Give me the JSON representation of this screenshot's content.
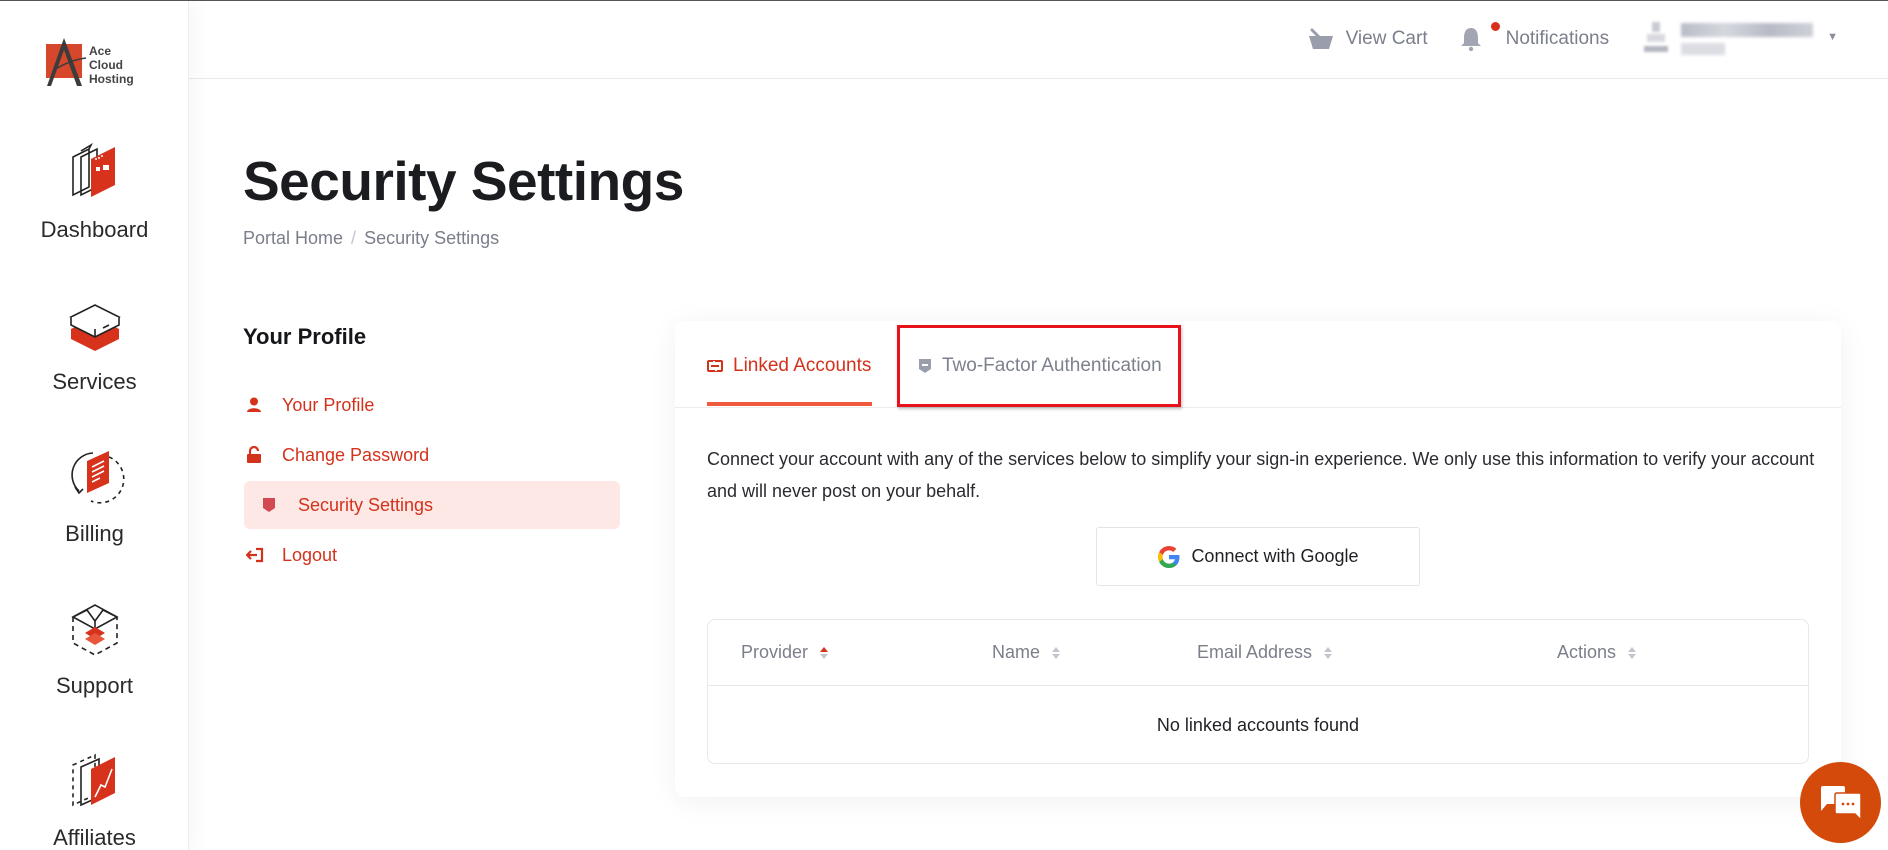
{
  "brand": {
    "name_lines": [
      "Ace",
      "Cloud",
      "Hosting"
    ],
    "accent_color": "#d3321c",
    "logo_red": "#d6472b"
  },
  "nav": {
    "items": [
      {
        "label": "Dashboard",
        "icon": "dashboard-icon"
      },
      {
        "label": "Services",
        "icon": "services-icon"
      },
      {
        "label": "Billing",
        "icon": "billing-icon"
      },
      {
        "label": "Support",
        "icon": "support-icon"
      },
      {
        "label": "Affiliates",
        "icon": "affiliates-icon"
      }
    ]
  },
  "header": {
    "view_cart": "View Cart",
    "notifications": "Notifications",
    "notifications_has_unread": true,
    "user_name_blurred": true
  },
  "page": {
    "title": "Security Settings",
    "breadcrumb": [
      {
        "label": "Portal Home"
      },
      {
        "label": "Security Settings"
      }
    ]
  },
  "profile_menu": {
    "heading": "Your Profile",
    "items": [
      {
        "label": "Your Profile",
        "icon": "user-icon",
        "active": false
      },
      {
        "label": "Change Password",
        "icon": "unlock-icon",
        "active": false
      },
      {
        "label": "Security Settings",
        "icon": "shield-icon",
        "active": true
      },
      {
        "label": "Logout",
        "icon": "logout-icon",
        "active": false
      }
    ]
  },
  "tabs": [
    {
      "label": "Linked Accounts",
      "icon": "link-icon",
      "active": true
    },
    {
      "label": "Two-Factor Authentication",
      "icon": "shield-icon",
      "active": false,
      "highlighted": true
    }
  ],
  "linked_accounts": {
    "description": "Connect your account with any of the services below to simplify your sign-in experience. We only use this information to verify your account and will never post on your behalf.",
    "connect_google_label": "Connect with Google",
    "table": {
      "columns": [
        {
          "label": "Provider",
          "sorted": "asc"
        },
        {
          "label": "Name",
          "sorted": null
        },
        {
          "label": "Email Address",
          "sorted": null
        },
        {
          "label": "Actions",
          "sorted": null
        }
      ],
      "rows": [],
      "empty_message": "No linked accounts found"
    }
  },
  "chat_widget": {
    "icon": "chat-icon",
    "color": "#d34a0b"
  }
}
